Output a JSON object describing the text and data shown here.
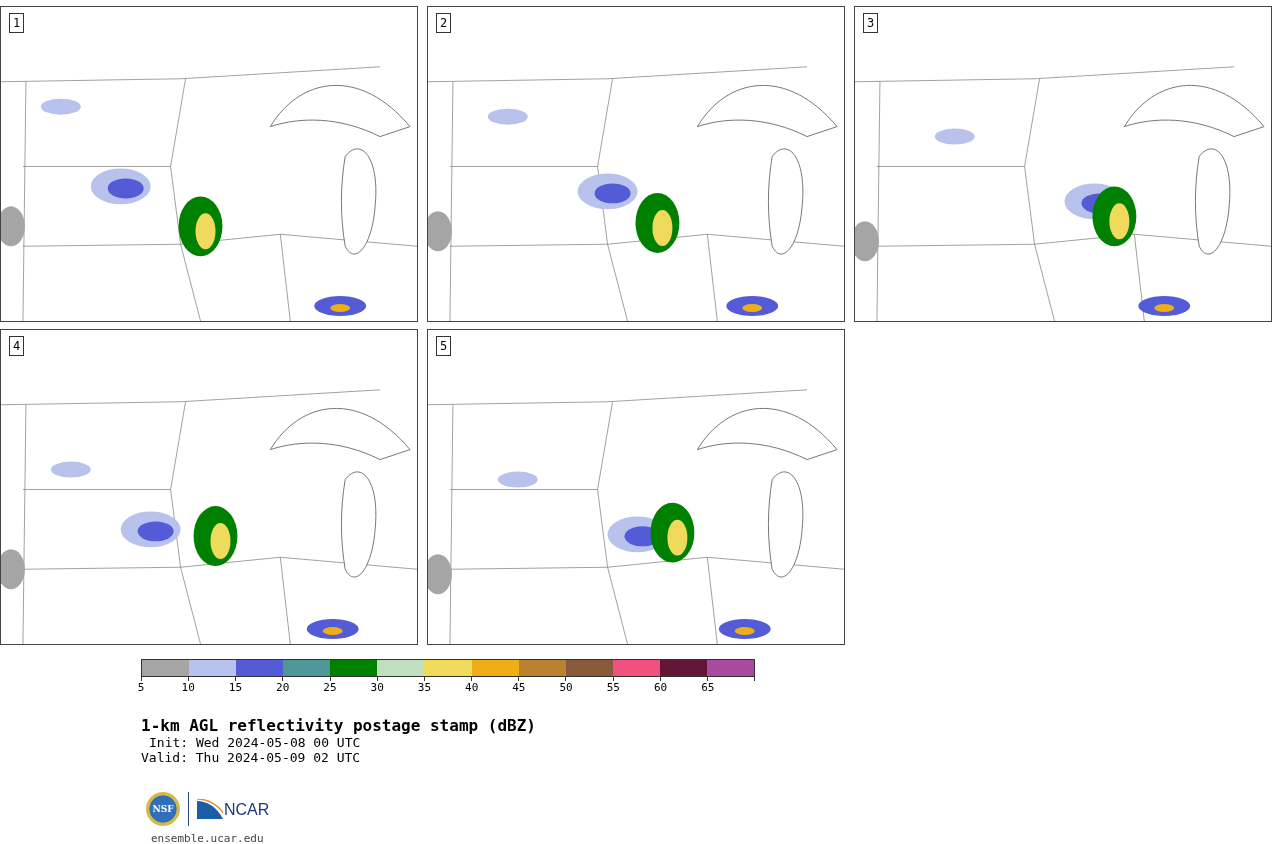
{
  "panels": [
    {
      "label": "1"
    },
    {
      "label": "2"
    },
    {
      "label": "3"
    },
    {
      "label": "4"
    },
    {
      "label": "5"
    }
  ],
  "colorbar": {
    "segments": [
      {
        "color": "#a5a5a5"
      },
      {
        "color": "#b8c2ec"
      },
      {
        "color": "#535bd6"
      },
      {
        "color": "#4f9699"
      },
      {
        "color": "#008000"
      },
      {
        "color": "#c0dfc0"
      },
      {
        "color": "#f0da5c"
      },
      {
        "color": "#efae18"
      },
      {
        "color": "#b9822f"
      },
      {
        "color": "#8a5a3d"
      },
      {
        "color": "#f25180"
      },
      {
        "color": "#611638"
      },
      {
        "color": "#a94aa0"
      }
    ],
    "ticks": [
      "5",
      "10",
      "15",
      "20",
      "25",
      "30",
      "35",
      "40",
      "45",
      "50",
      "55",
      "60",
      "65"
    ]
  },
  "title": "1-km AGL reflectivity postage stamp (dBZ)",
  "init": "Init: Wed 2024-05-08 00 UTC",
  "valid": "Valid: Thu 2024-05-09 02 UTC",
  "logos": {
    "nsf": "NSF",
    "ncar": "NCAR"
  },
  "footer_link": "ensemble.ucar.edu"
}
